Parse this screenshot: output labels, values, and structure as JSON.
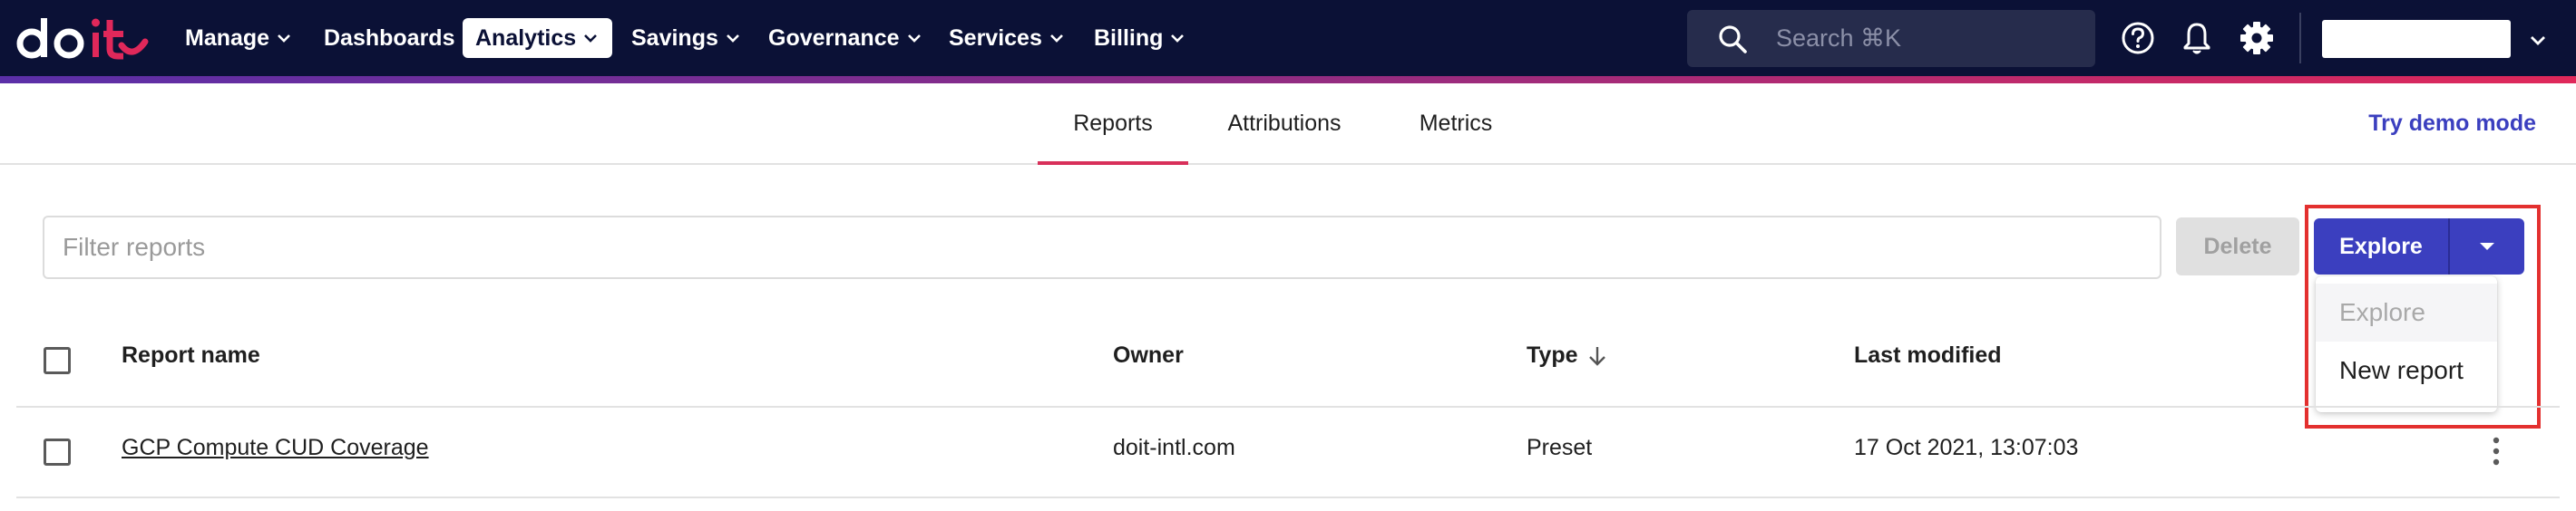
{
  "brand": {
    "logo_text": "doit"
  },
  "topnav": {
    "items": [
      {
        "label": "Manage",
        "has_chevron": true
      },
      {
        "label": "Dashboards",
        "has_chevron": false
      },
      {
        "label": "Analytics",
        "has_chevron": true,
        "active": true
      },
      {
        "label": "Savings",
        "has_chevron": true
      },
      {
        "label": "Governance",
        "has_chevron": true
      },
      {
        "label": "Services",
        "has_chevron": true
      },
      {
        "label": "Billing",
        "has_chevron": true
      }
    ],
    "search_placeholder": "Search ⌘K",
    "icons": [
      "help-icon",
      "bell-icon",
      "gear-icon",
      "chevron-down-icon"
    ]
  },
  "subnav": {
    "tabs": [
      {
        "label": "Reports",
        "active": true
      },
      {
        "label": "Attributions",
        "active": false
      },
      {
        "label": "Metrics",
        "active": false
      }
    ],
    "demo_link": "Try demo mode"
  },
  "toolbar": {
    "filter_placeholder": "Filter reports",
    "delete_label": "Delete",
    "explore_label": "Explore"
  },
  "explore_menu": {
    "items": [
      {
        "label": "Explore",
        "disabled": true
      },
      {
        "label": "New report",
        "disabled": false
      }
    ]
  },
  "table": {
    "columns": [
      "Report name",
      "Owner",
      "Type",
      "Last modified"
    ],
    "sort_column": "Type",
    "rows": [
      {
        "name": "GCP Compute CUD Coverage",
        "owner": "doit-intl.com",
        "type": "Preset",
        "last_modified": "17 Oct 2021, 13:07:03"
      }
    ]
  },
  "colors": {
    "nav_bg": "#0b1136",
    "accent": "#3b3fbf",
    "tab_underline": "#d8305a",
    "highlight": "#e3302f",
    "logo_accent": "#e0285a"
  }
}
